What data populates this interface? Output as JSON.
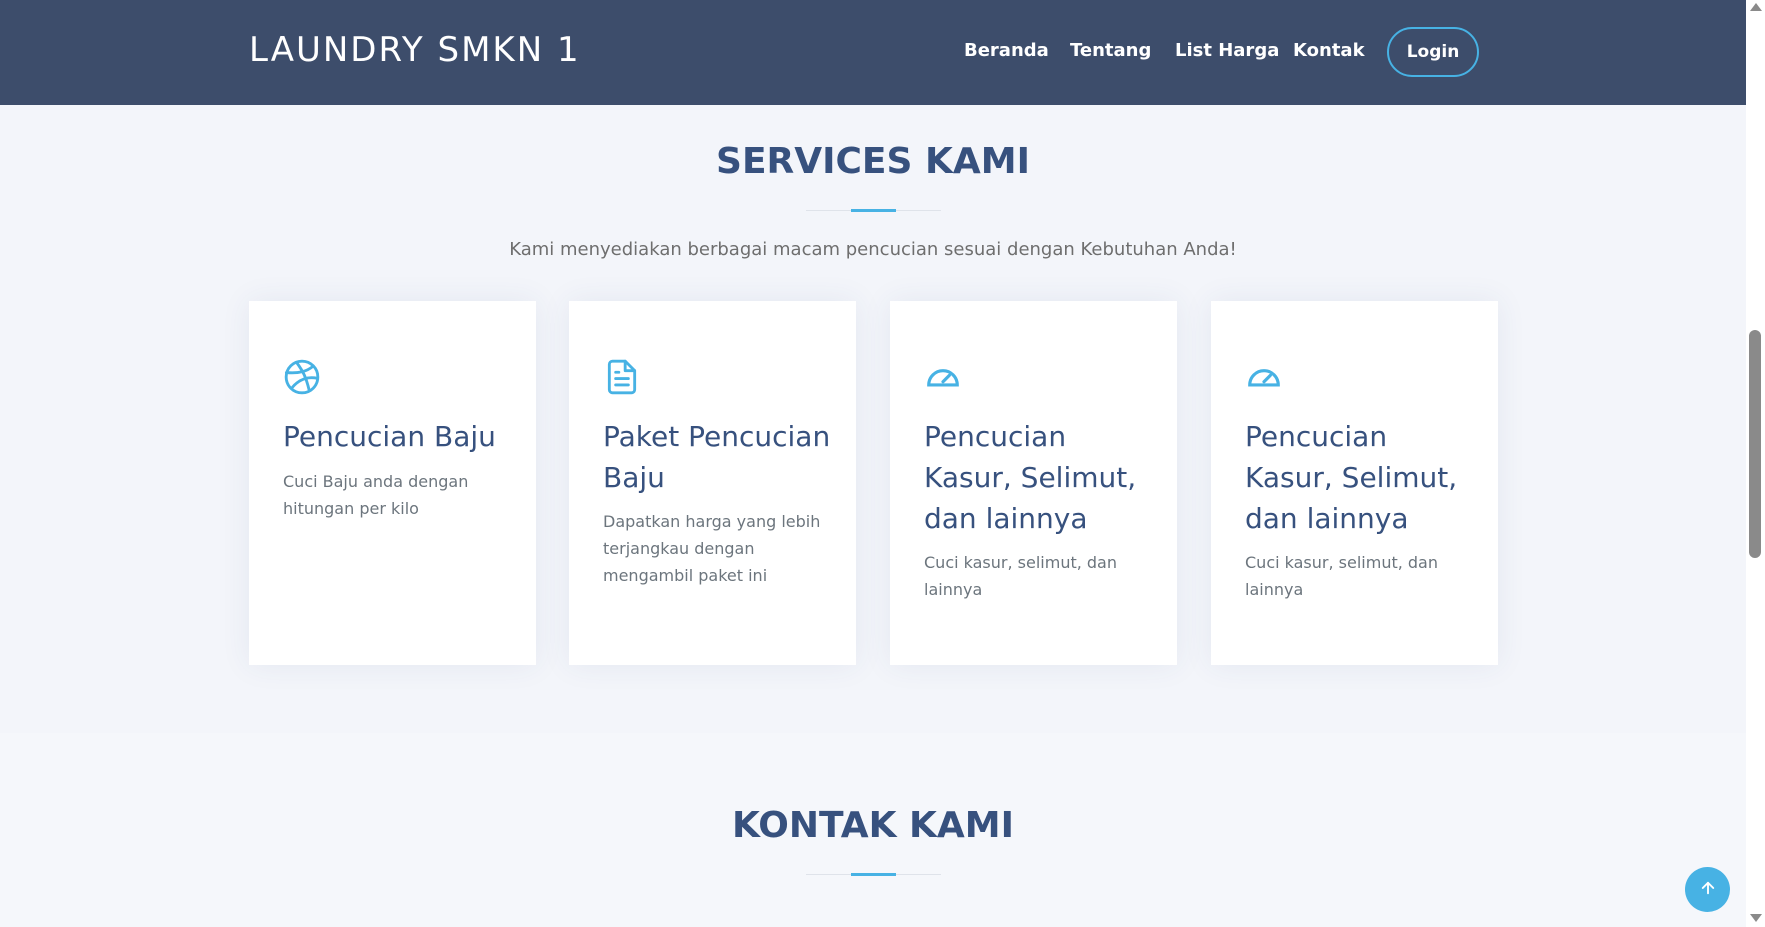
{
  "header": {
    "brand": "LAUNDRY SMKN 1",
    "nav": [
      "Beranda",
      "Tentang",
      "List Harga",
      "Kontak"
    ],
    "login_label": "Login"
  },
  "services": {
    "title": "SERVICES KAMI",
    "subtitle": "Kami menyediakan berbagai macam pencucian sesuai dengan Kebutuhan Anda!",
    "cards": [
      {
        "icon": "dribbble-icon",
        "title": "Pencucian Baju",
        "desc": "Cuci Baju anda dengan hitungan per kilo"
      },
      {
        "icon": "file-text-icon",
        "title": "Paket Pencucian Baju",
        "desc": "Dapatkan harga yang lebih terjangkau dengan mengambil paket ini"
      },
      {
        "icon": "speedometer-icon",
        "title": "Pencucian Kasur, Selimut, dan lainnya",
        "desc": "Cuci kasur, selimut, dan lainnya"
      },
      {
        "icon": "speedometer-icon",
        "title": "Pencucian Kasur, Selimut, dan lainnya",
        "desc": "Cuci kasur, selimut, dan lainnya"
      }
    ]
  },
  "kontak": {
    "title": "KONTAK KAMI"
  },
  "colors": {
    "navbar": "#3d4d6b",
    "heading": "#37517e",
    "accent": "#47b2e4",
    "section_bg": "#f3f5fa"
  },
  "icons": {
    "back_to_top": "arrow-up-icon"
  }
}
